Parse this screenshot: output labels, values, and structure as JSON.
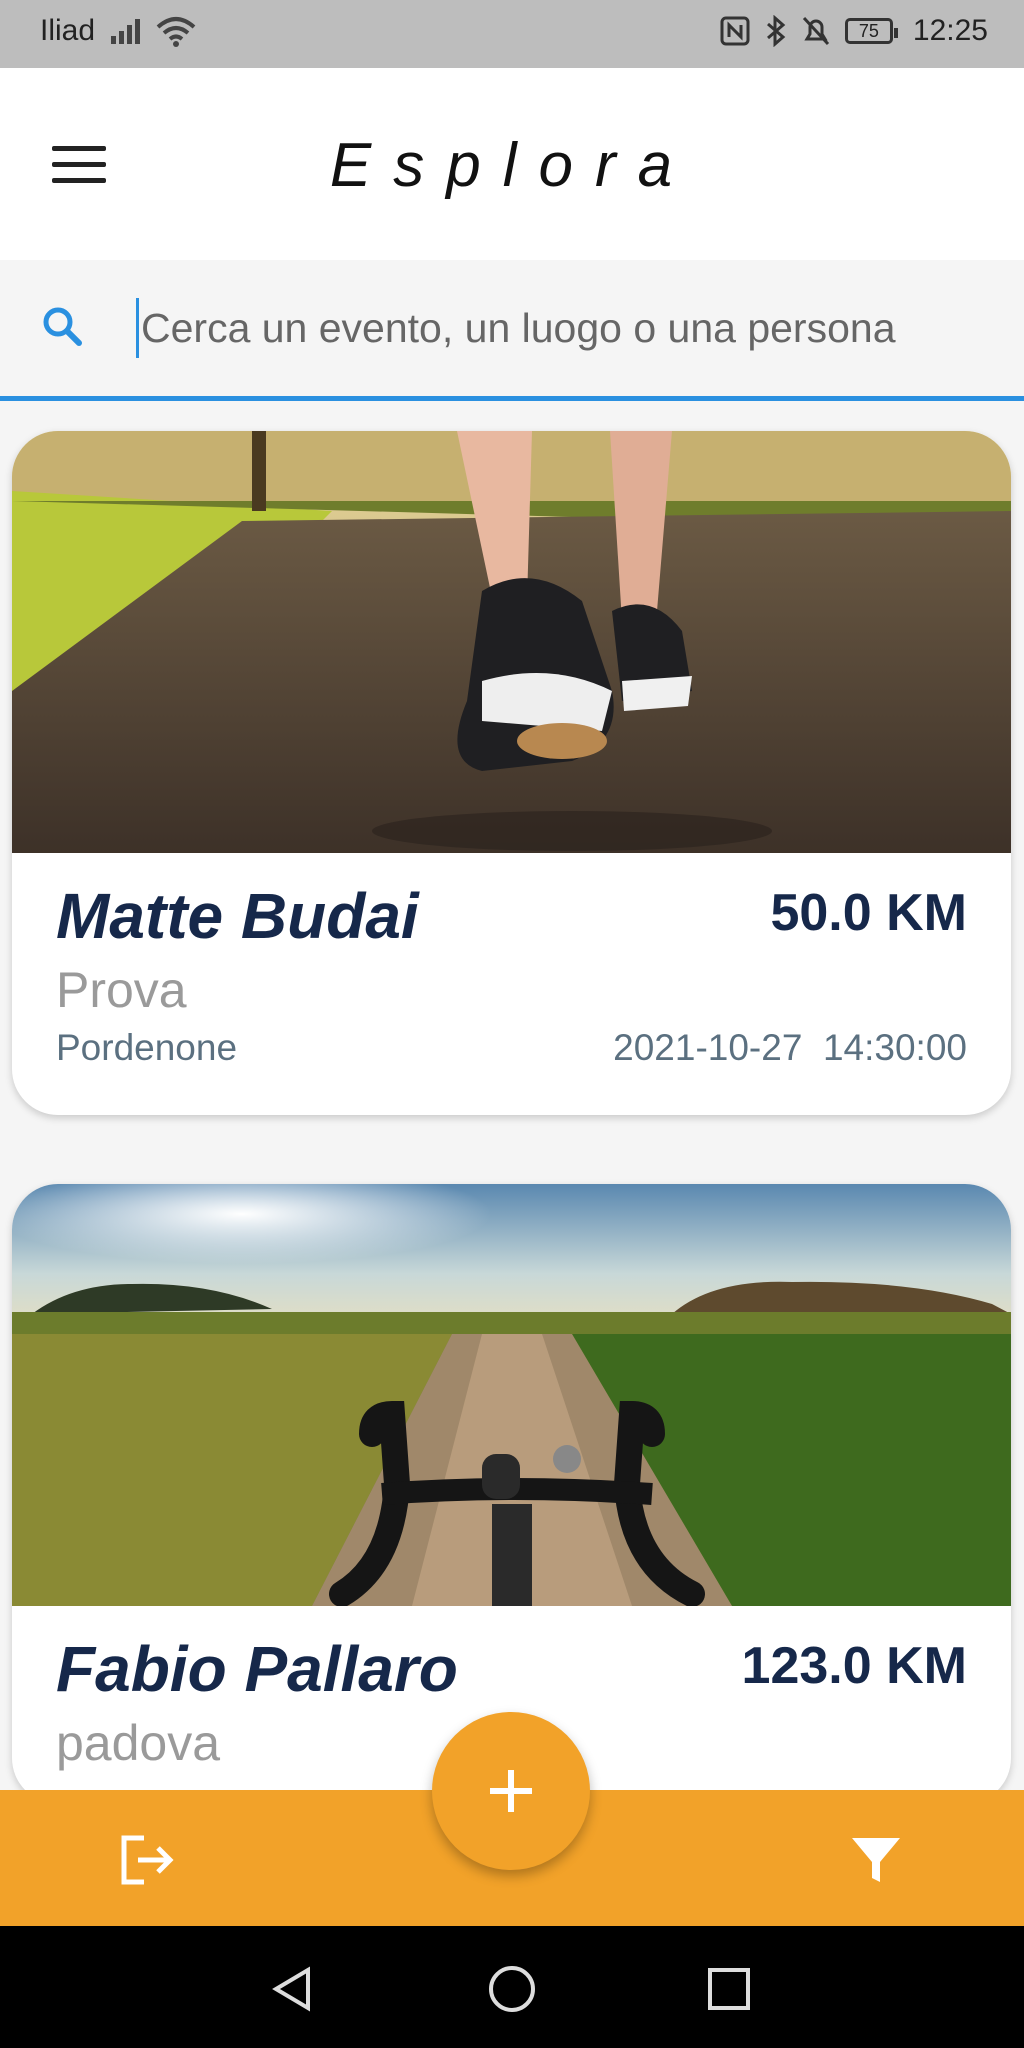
{
  "status_bar": {
    "carrier": "Iliad",
    "battery": "75",
    "time": "12:25"
  },
  "header": {
    "title": "Esplora",
    "menu_icon": "hamburger-menu-icon"
  },
  "search": {
    "placeholder": "Cerca un evento, un luogo o una persona",
    "value": "",
    "icon": "search-icon",
    "accent_color": "#2a90e0"
  },
  "events": [
    {
      "name": "Matte Budai",
      "distance": "50.0 KM",
      "description": "Prova",
      "place": "Pordenone",
      "date": "2021-10-27",
      "time": "14:30:00",
      "image": "running-shoes-path-photo"
    },
    {
      "name": "Fabio Pallaro",
      "distance": "123.0 KM",
      "description": "padova",
      "image": "bike-handlebars-country-road-photo"
    }
  ],
  "bottom_bar": {
    "color": "#f2a229",
    "left_icon": "logout-icon",
    "right_icon": "filter-icon",
    "fab_icon": "plus-icon"
  },
  "system_nav": {
    "back_icon": "back-triangle-icon",
    "home_icon": "home-circle-icon",
    "recents_icon": "recents-square-icon"
  }
}
